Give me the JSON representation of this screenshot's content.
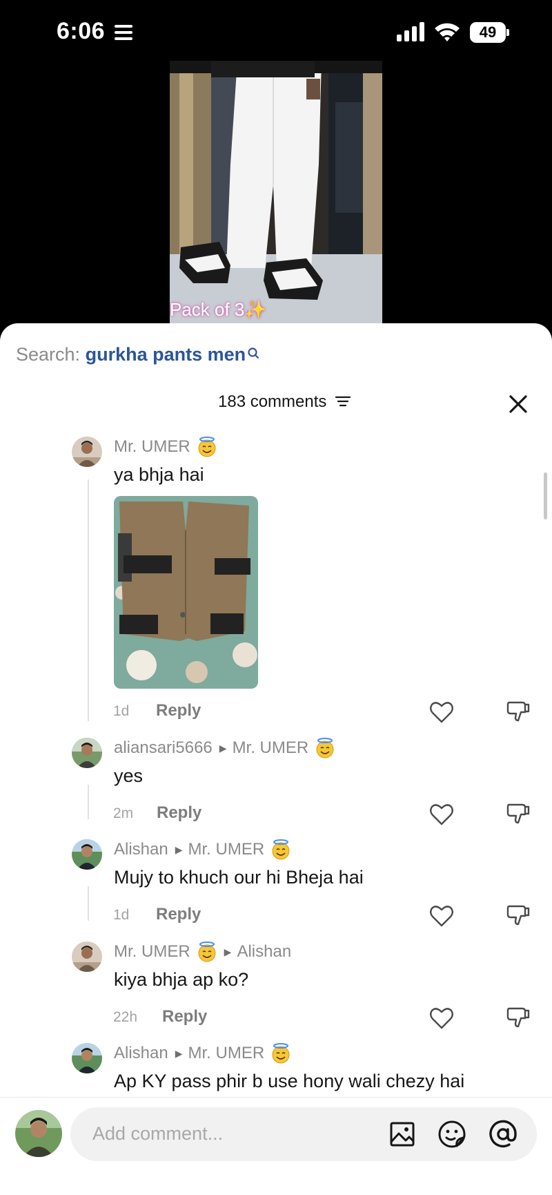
{
  "status_bar": {
    "time": "6:06",
    "battery": "49"
  },
  "video": {
    "caption": "Pack of 3✨"
  },
  "search": {
    "prefix": "Search:",
    "query": "gurkha pants men"
  },
  "comments_header": {
    "count": "183 comments"
  },
  "comments": [
    {
      "username": "Mr. UMER",
      "reply_to": "",
      "text": "ya bhja hai",
      "time": "1d",
      "reply_label": "Reply",
      "has_halo_emoji": true
    },
    {
      "username": "aliansari5666",
      "reply_to": "Mr. UMER",
      "text": "yes",
      "time": "2m",
      "reply_label": "Reply"
    },
    {
      "username": "Alishan",
      "reply_to": "Mr. UMER",
      "text": "Mujy to khuch our hi Bheja hai",
      "time": "1d",
      "reply_label": "Reply"
    },
    {
      "username": "Mr. UMER",
      "reply_to": "Alishan",
      "text": "kiya bhja ap ko?",
      "time": "22h",
      "reply_label": "Reply",
      "has_halo_emoji": true
    },
    {
      "username": "Alishan",
      "reply_to": "Mr. UMER",
      "text": "Ap KY pass phir b use hony wali chezy hai",
      "time": "",
      "reply_label": ""
    }
  ],
  "input": {
    "placeholder": "Add comment..."
  },
  "icons": {
    "menu": "list-icon",
    "signal": "cellular-signal-icon",
    "wifi": "wifi-icon",
    "battery": "battery-icon",
    "search": "search-icon",
    "sort": "sort-icon",
    "close": "close-icon",
    "like": "heart-icon",
    "dislike": "thumbs-down-icon",
    "image": "image-icon",
    "emoji": "emoji-icon",
    "mention": "at-icon",
    "halo": "smiling-face-with-halo-emoji"
  },
  "colors": {
    "accent_query": "#2b5597",
    "text_primary": "#161616",
    "text_secondary": "#8a8a8a"
  }
}
